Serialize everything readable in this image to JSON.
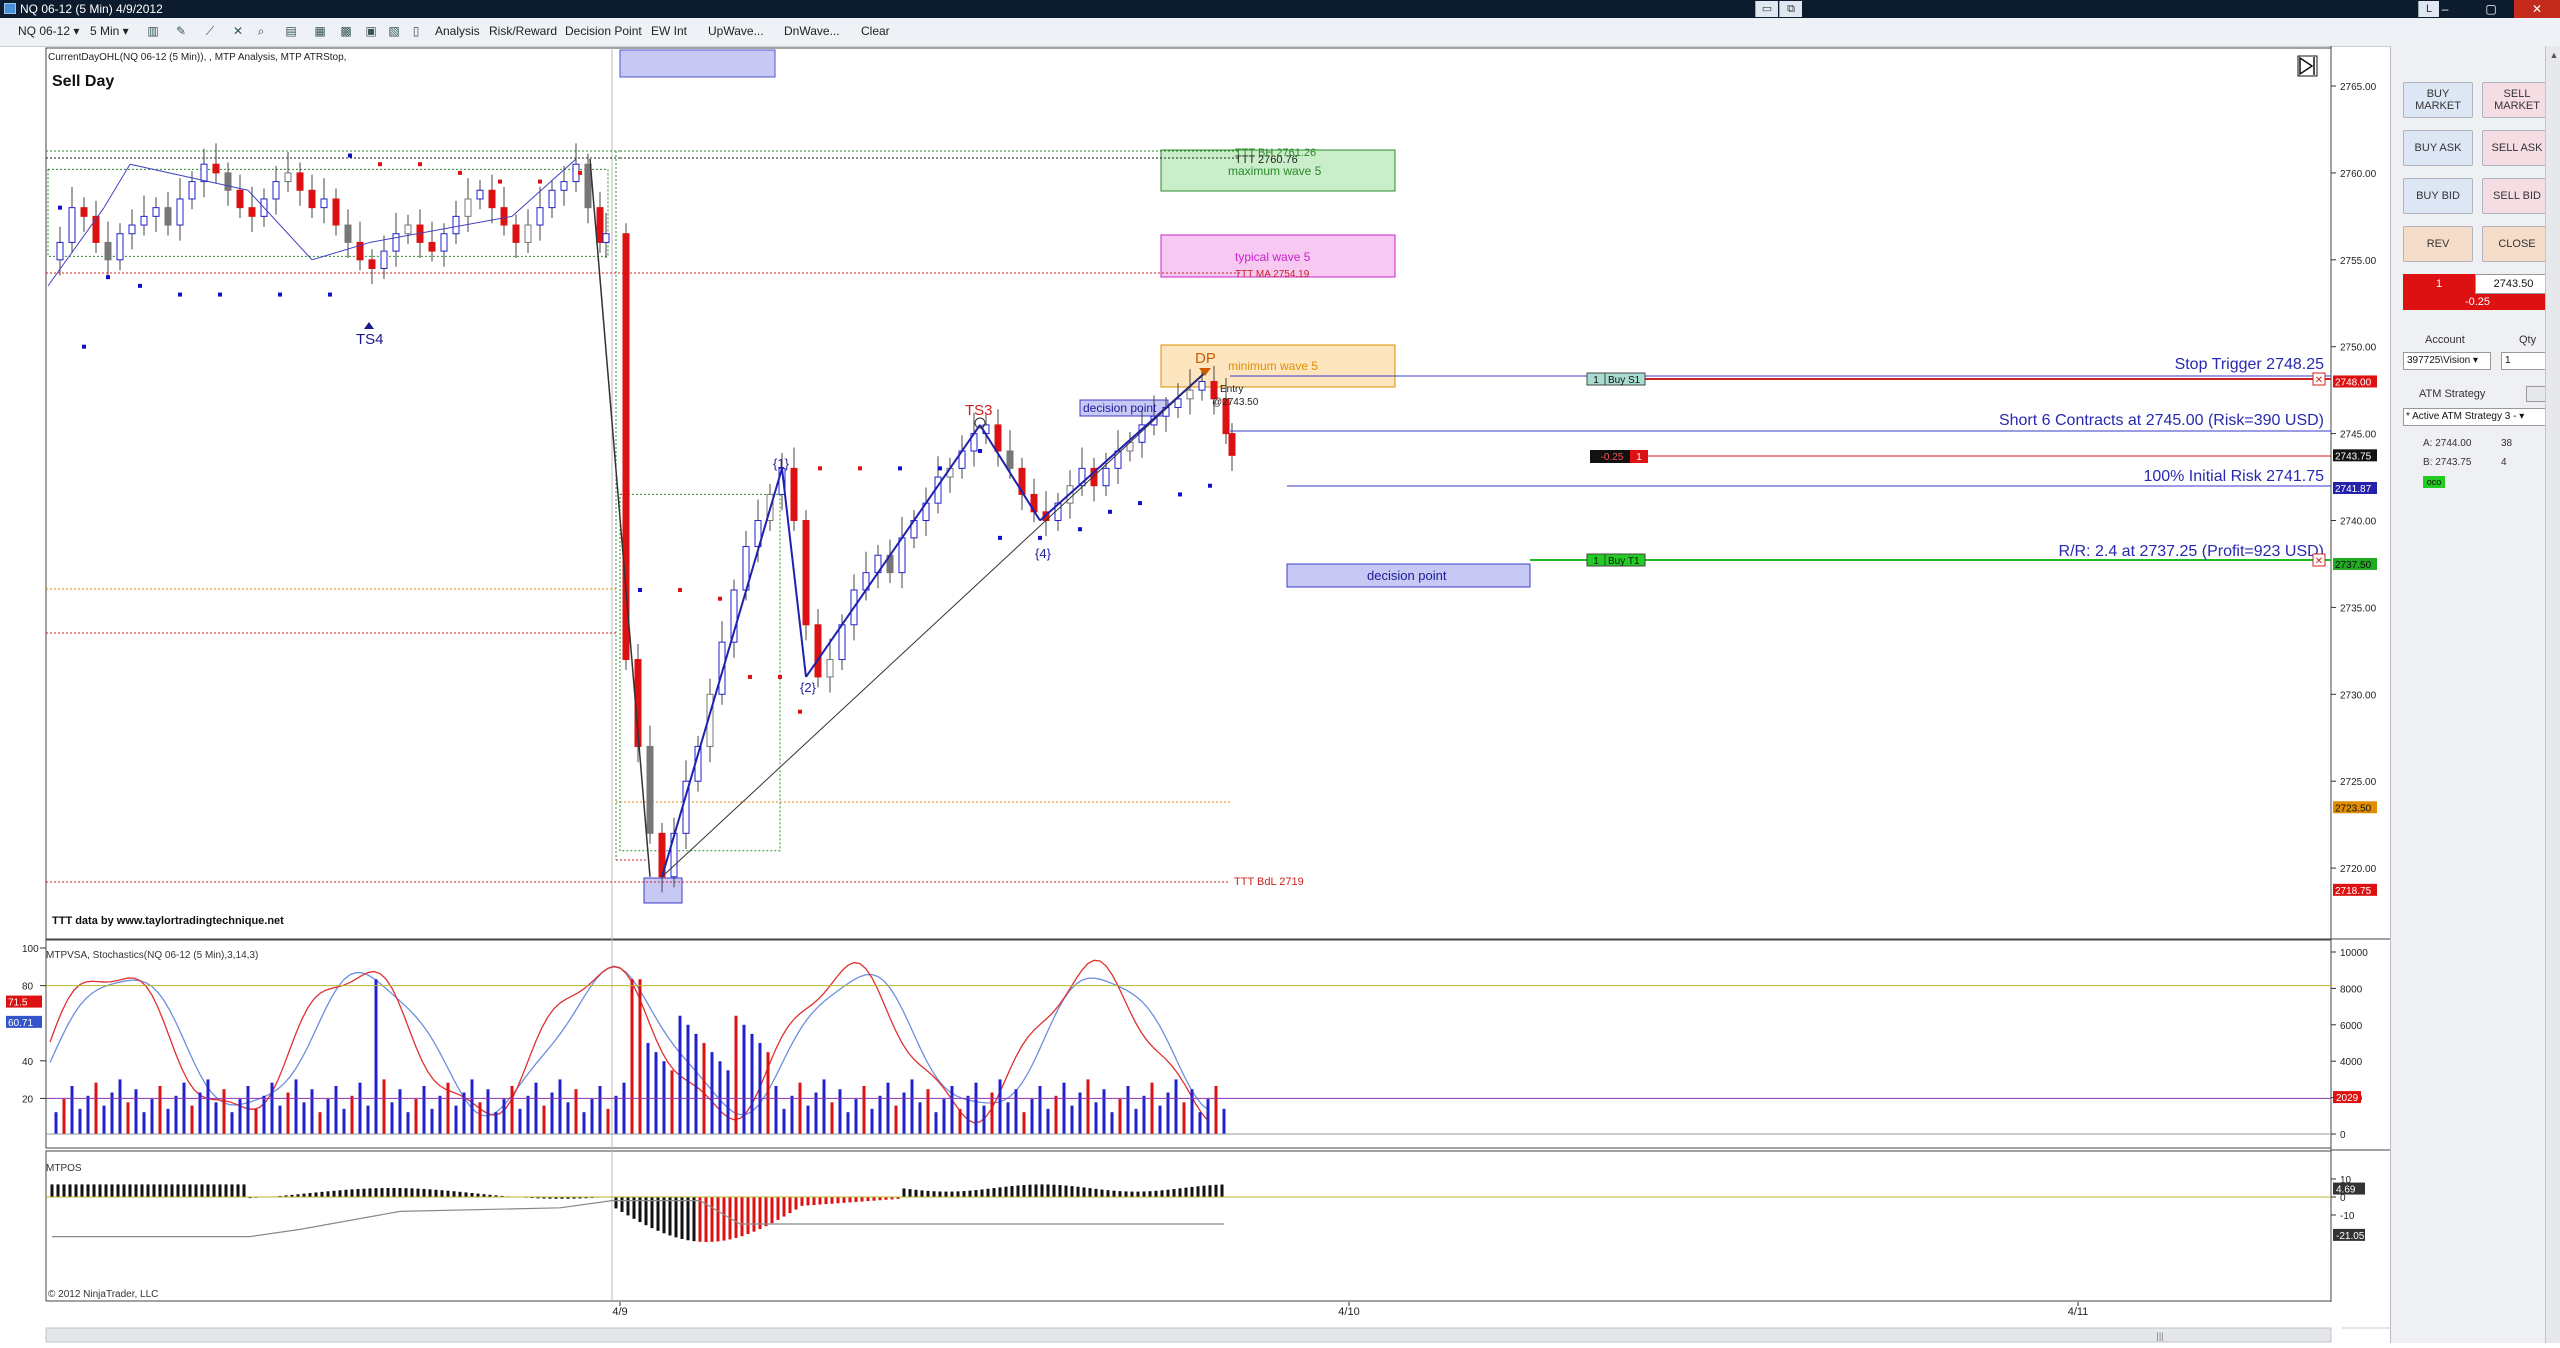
{
  "window": {
    "title": "NQ 06-12 (5 Min)  4/9/2012",
    "min_label": "–",
    "max_label": "▢",
    "close_label": "✕",
    "link_label": "L"
  },
  "toolbar": {
    "instrument": "NQ 06-12",
    "interval": "5 Min",
    "items": [
      "Analysis",
      "Risk/Reward",
      "Decision Point",
      "EW Int",
      "UpWave...",
      "DnWave...",
      "Clear"
    ]
  },
  "chart": {
    "indicator_header": "CurrentDayOHL(NQ 06-12 (5 Min)), , MTP Analysis, MTP ATRStop,",
    "sell_day": "Sell Day",
    "ttt_credit": "TTT data by www.taylortradingtechnique.net",
    "copyright": "© 2012 NinjaTrader, LLC",
    "stoch_header": "MTPVSA, Stochastics(NQ 06-12 (5 Min),3,14,3)",
    "osc_header": "MTPOS",
    "annotations": {
      "ts4": "TS4",
      "ts3": "TS3",
      "dp": "DP",
      "w1": "{1}",
      "w2": "{2}",
      "w4": "{4}",
      "decision_point_small": "decision point",
      "decision_point_box": "decision point",
      "max_wave5": "maximum wave 5",
      "typical_wave5": "typical wave 5",
      "min_wave5": "minimum wave 5",
      "ttt_bh": "TTT BH 2761.26",
      "ttt_2760": "TTT 2760.76",
      "ttt_ma": "TTT MA 2754.19",
      "ttt_bdl": "TTT BdL 2719",
      "entry": "Entry",
      "entry_price": "@2743.50",
      "stop_trigger": "Stop Trigger 2748.25",
      "short_text": "Short 6 Contracts at 2745.00 (Risk=390 USD)",
      "initial_risk": "100% Initial Risk 2741.75",
      "rr_text": "R/R: 2.4 at 2737.25 (Profit=923 USD)",
      "order_stop_qty": "1",
      "order_stop_label": "Buy S1",
      "order_target_qty": "1",
      "order_target_label": "Buy T1",
      "pos_pnl": "-0.25",
      "pos_qty": "1"
    },
    "price_axis": [
      "2765.00",
      "2760.00",
      "2755.00",
      "2750.00",
      "2745.00",
      "2740.00",
      "2735.00",
      "2730.00",
      "2725.00",
      "2720.00"
    ],
    "price_markers": {
      "stop": "2748.00",
      "last": "2743.75",
      "risk": "2741.87",
      "target": "2737.50",
      "orange": "2723.50",
      "bdl": "2718.75"
    },
    "stoch_axis_left": [
      "100",
      "80",
      "40",
      "20"
    ],
    "stoch_markers_left": [
      "71.5",
      "60.71"
    ],
    "vol_axis_right": [
      "10000",
      "8000",
      "6000",
      "4000",
      "2000",
      "0"
    ],
    "vol_marker": "2029",
    "osc_axis": [
      "10",
      "0",
      "-10"
    ],
    "osc_markers": [
      "4.69",
      "-21.05"
    ],
    "time_axis": [
      "4/9",
      "4/10",
      "4/11"
    ],
    "scrollbar_grip": "|||",
    "colors": {
      "up": "#2222cc",
      "down": "#dd1111",
      "stoch_k": "#e03030",
      "stoch_d": "#6d8fe0",
      "atrstop": "#1010cc",
      "wave_line": "#2020b0"
    }
  },
  "side_panel": {
    "buy_market": "BUY MARKET",
    "sell_market": "SELL MARKET",
    "buy_ask": "BUY ASK",
    "sell_ask": "SELL ASK",
    "buy_bid": "BUY BID",
    "sell_bid": "SELL BID",
    "rev": "REV",
    "close": "CLOSE",
    "pos_qty": "1",
    "pos_price": "2743.50",
    "pos_pnl": "-0.25",
    "account_label": "Account",
    "qty_label": "Qty",
    "account_value": "397725\\Vision",
    "qty_value": "1",
    "atm_label": "ATM Strategy",
    "atm_value": "* Active ATM Strategy 3 - ",
    "ask_label": "A: 2744.00",
    "ask_size": "38",
    "bid_label": "B: 2743.75",
    "bid_size": "4",
    "oco": "oco"
  }
}
